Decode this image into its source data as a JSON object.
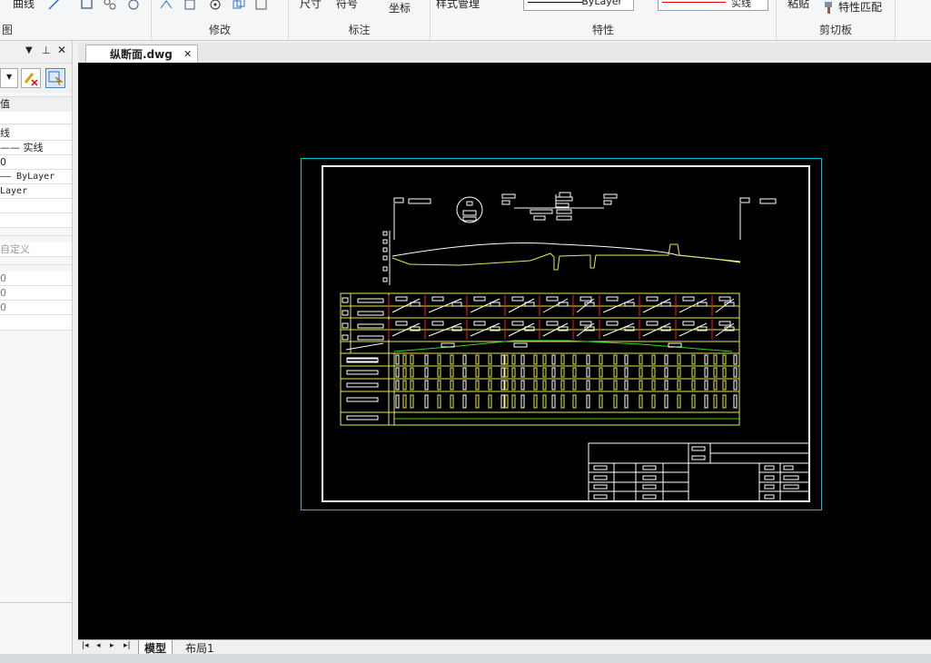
{
  "ribbon": {
    "sections": [
      {
        "label": "图",
        "items": [
          "曲线"
        ]
      },
      {
        "label": "修改",
        "items": []
      },
      {
        "label": "标注",
        "items": [
          "尺寸",
          "符号",
          "坐标"
        ]
      },
      {
        "label": "特性",
        "items": [
          "样式管理",
          "ByLayer",
          "实线"
        ]
      },
      {
        "label": "剪切板",
        "items": [
          "粘贴",
          "特性匹配"
        ]
      }
    ]
  },
  "properties_panel": {
    "header_col": "值",
    "rows": [
      "线",
      "—— 实线",
      "0",
      "——  ByLayer",
      "Layer",
      "",
      "",
      "自定义",
      "0",
      "0",
      "0"
    ]
  },
  "tabs": {
    "document": "纵断面.dwg"
  },
  "layouts": [
    "模型",
    "布局1"
  ],
  "colors": {
    "canvas": "#000000",
    "frame_outer": "#00c8d2",
    "frame_inner": "#ffffff",
    "table_yellow": "#e8e84a",
    "profile_yellow": "#e8e84a",
    "red": "#ff1a1a",
    "green": "#2bd62b"
  }
}
